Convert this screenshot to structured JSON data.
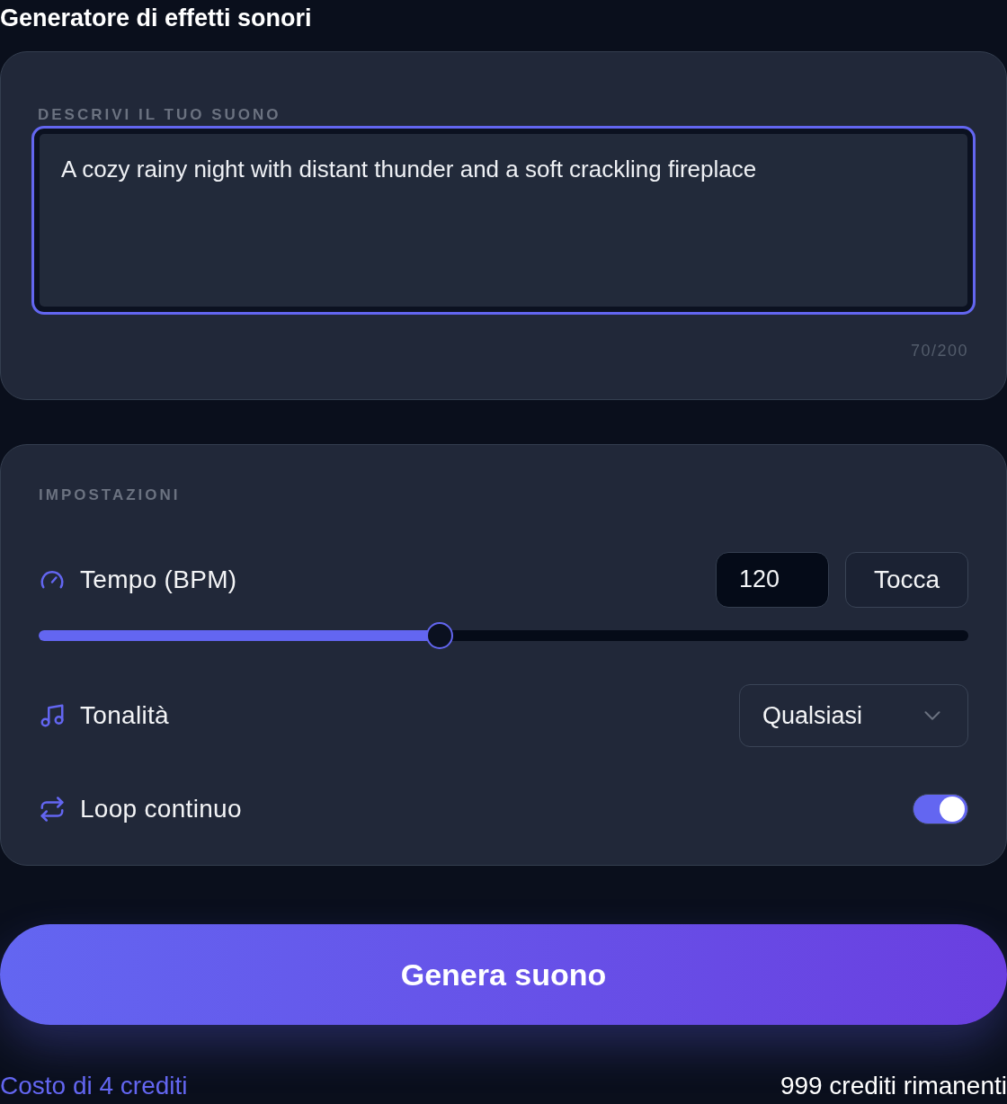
{
  "title": "Generatore di effetti sonori",
  "description": {
    "label": "DESCRIVI IL TUO SUONO",
    "value": "A cozy rainy night with distant thunder and a soft crackling fireplace",
    "focused": true,
    "counter": "70/200"
  },
  "settings": {
    "label": "IMPOSTAZIONI",
    "rows": [
      {
        "kind": "tempo",
        "label": "Tempo (BPM)",
        "value": "120",
        "button": "Tocca",
        "level": 0.431
      },
      {
        "kind": "select",
        "label": "Tonalità",
        "value": "Qualsiasi"
      },
      {
        "kind": "toggle",
        "label": "Loop continuo",
        "on": true
      }
    ]
  },
  "generate_button": "Genera suono",
  "footer": {
    "cost": "Costo di 4 crediti",
    "remaining": "999 crediti rimanenti"
  }
}
